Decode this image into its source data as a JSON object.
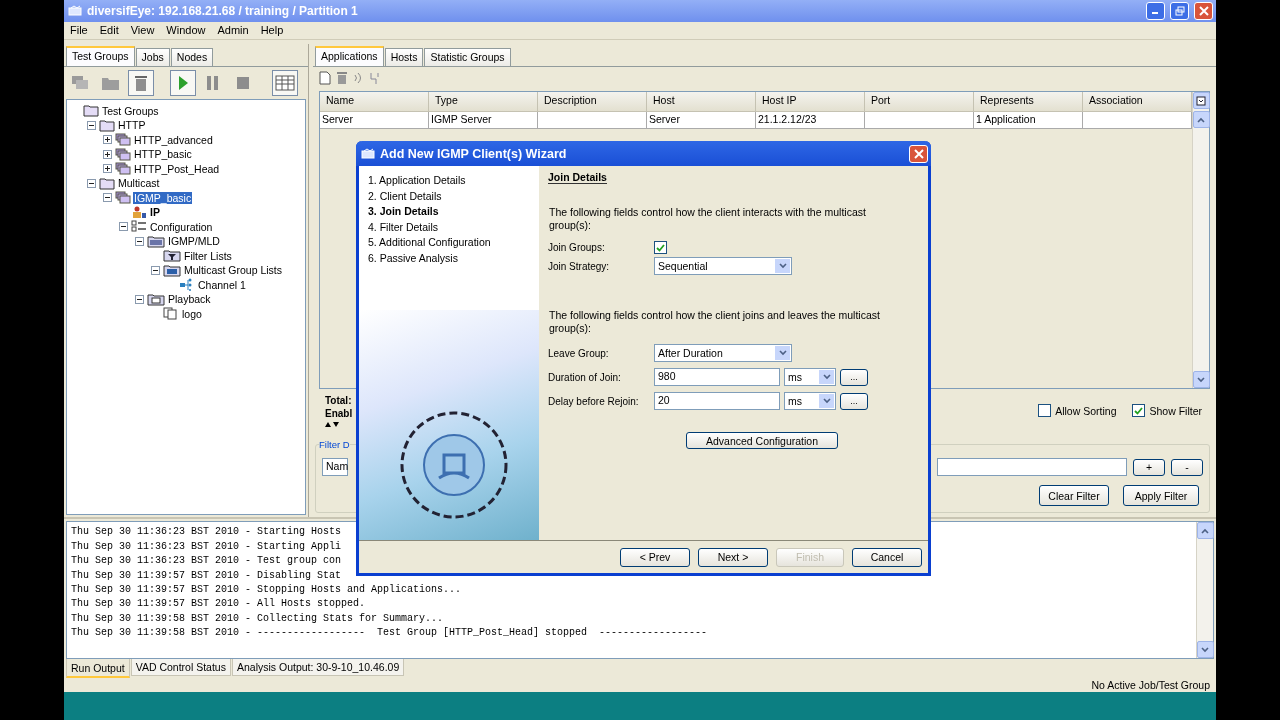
{
  "window": {
    "title": "diversifEye: 192.168.21.68 / training / Partition 1"
  },
  "menu": [
    "File",
    "Edit",
    "View",
    "Window",
    "Admin",
    "Help"
  ],
  "left_tabs": [
    {
      "label": "Test Groups",
      "selected": true
    },
    {
      "label": "Jobs",
      "selected": false
    },
    {
      "label": "Nodes",
      "selected": false
    }
  ],
  "tree": [
    {
      "label": "Test Groups",
      "kind": "folder",
      "selected": false,
      "children": [
        {
          "label": "HTTP",
          "kind": "folder",
          "selected": false,
          "expanded": true,
          "children": [
            {
              "label": "HTTP_advanced",
              "kind": "group",
              "selected": false,
              "expanded": false
            },
            {
              "label": "HTTP_basic",
              "kind": "group",
              "selected": false,
              "expanded": false
            },
            {
              "label": "HTTP_Post_Head",
              "kind": "group",
              "selected": false,
              "expanded": false
            }
          ]
        },
        {
          "label": "Multicast",
          "kind": "folder",
          "selected": false,
          "expanded": true,
          "children": [
            {
              "label": "IGMP_basic",
              "kind": "group",
              "selected": true,
              "expanded": true,
              "children": [
                {
                  "label": "IP",
                  "kind": "ip",
                  "selected": false,
                  "bold": true
                },
                {
                  "label": "Configuration",
                  "kind": "config",
                  "selected": false,
                  "expanded": true,
                  "children": [
                    {
                      "label": "IGMP/MLD",
                      "kind": "module",
                      "selected": false,
                      "expanded": true,
                      "children": [
                        {
                          "label": "Filter Lists",
                          "kind": "filter",
                          "selected": false
                        },
                        {
                          "label": "Multicast Group Lists",
                          "kind": "list",
                          "selected": false,
                          "expanded": true,
                          "children": [
                            {
                              "label": "Channel 1",
                              "kind": "channel",
                              "selected": false
                            }
                          ]
                        }
                      ]
                    },
                    {
                      "label": "Playback",
                      "kind": "playback",
                      "selected": false,
                      "expanded": true,
                      "children": [
                        {
                          "label": "logo",
                          "kind": "file",
                          "selected": false
                        }
                      ]
                    }
                  ]
                }
              ]
            }
          ]
        }
      ]
    }
  ],
  "right_tabs": [
    {
      "label": "Applications",
      "selected": true
    },
    {
      "label": "Hosts",
      "selected": false
    },
    {
      "label": "Statistic Groups",
      "selected": false
    }
  ],
  "table": {
    "columns": [
      "Name",
      "Type",
      "Description",
      "Host",
      "Host IP",
      "Port",
      "Represents",
      "Association"
    ],
    "rows": [
      [
        "Server",
        "IGMP Server",
        "",
        "Server",
        "21.1.2.12/23",
        "",
        "1 Application",
        ""
      ]
    ]
  },
  "summary": {
    "total_label": "Total:",
    "enabled_label": "Enabl"
  },
  "options": [
    {
      "label": "Allow Sorting",
      "checked": false
    },
    {
      "label": "Show Filter",
      "checked": true
    }
  ],
  "filter": {
    "legend": "Filter D",
    "field": "Nam",
    "add": "+",
    "remove": "-",
    "clear": "Clear Filter",
    "apply": "Apply Filter"
  },
  "wizard": {
    "title": "Add New IGMP Client(s) Wizard",
    "steps": [
      {
        "label": "1. Application Details",
        "selected": false
      },
      {
        "label": "2. Client Details",
        "selected": false
      },
      {
        "label": "3. Join Details",
        "selected": true
      },
      {
        "label": "4. Filter Details",
        "selected": false
      },
      {
        "label": "5. Additional Configuration",
        "selected": false
      },
      {
        "label": "6. Passive Analysis",
        "selected": false
      }
    ],
    "heading": "Join Details",
    "intro": "The following fields control how the client interacts with the multicast group(s):",
    "join_groups": {
      "label": "Join Groups:",
      "checked": true
    },
    "join_strategy": {
      "label": "Join Strategy:",
      "value": "Sequential"
    },
    "intro2": "The following fields control how the client joins and leaves the multicast group(s):",
    "leave_group": {
      "label": "Leave Group:",
      "value": "After Duration"
    },
    "timings": [
      {
        "label": "Duration of Join:",
        "value": "980",
        "unit": "ms",
        "more": "..."
      },
      {
        "label": "Delay before Rejoin:",
        "value": "20",
        "unit": "ms",
        "more": "..."
      }
    ],
    "advanced": "Advanced Configuration",
    "buttons": [
      {
        "label": "< Prev",
        "disabled": false
      },
      {
        "label": "Next >",
        "disabled": false
      },
      {
        "label": "Finish",
        "disabled": true
      },
      {
        "label": "Cancel",
        "disabled": false
      }
    ]
  },
  "log": [
    "Thu Sep 30 11:36:23 BST 2010 - Starting Hosts",
    "Thu Sep 30 11:36:23 BST 2010 - Starting Appli",
    "Thu Sep 30 11:36:23 BST 2010 - Test group con",
    "Thu Sep 30 11:39:57 BST 2010 - Disabling Stat",
    "Thu Sep 30 11:39:57 BST 2010 - Stopping Hosts and Applications...",
    "Thu Sep 30 11:39:57 BST 2010 - All Hosts stopped.",
    "Thu Sep 30 11:39:58 BST 2010 - Collecting Stats for Summary...",
    "Thu Sep 30 11:39:58 BST 2010 - ------------------  Test Group [HTTP_Post_Head] stopped  ------------------"
  ],
  "bottom_tabs": [
    {
      "label": "Run Output",
      "selected": true
    },
    {
      "label": "VAD Control Status",
      "selected": false
    },
    {
      "label": "Analysis Output: 30-9-10_10.46.09",
      "selected": false
    }
  ],
  "status_bar": "No Active Job/Test Group"
}
